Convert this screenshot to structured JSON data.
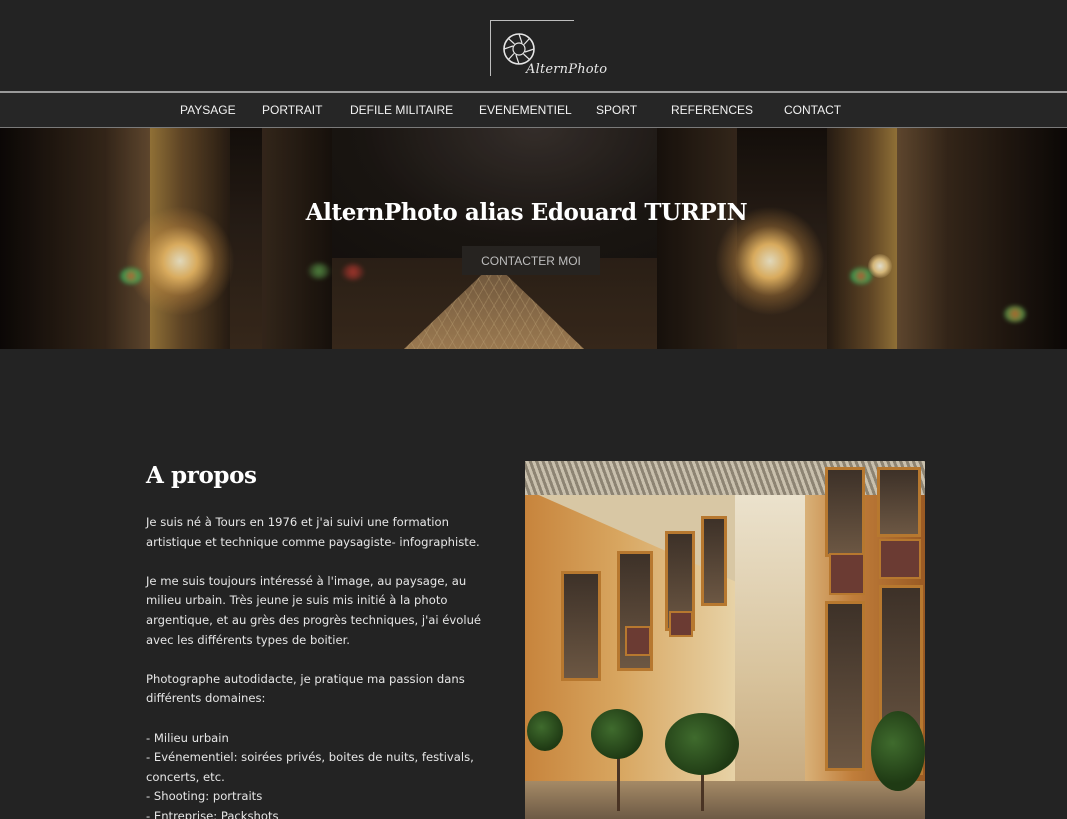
{
  "brand": {
    "logo_text": "AlternPhoto"
  },
  "nav": {
    "items": [
      {
        "label": "PAYSAGE"
      },
      {
        "label": "PORTRAIT"
      },
      {
        "label": "DEFILE MILITAIRE"
      },
      {
        "label": "EVENEMENTIEL"
      },
      {
        "label": "SPORT"
      },
      {
        "label": "REFERENCES"
      },
      {
        "label": "CONTACT"
      }
    ]
  },
  "hero": {
    "title": "AlternPhoto alias Edouard TURPIN",
    "button_label": "CONTACTER MOI"
  },
  "about": {
    "title": "A propos",
    "paragraphs": [
      "Je suis né à Tours en 1976 et j'ai suivi une formation artistique et technique comme paysagiste- infographiste.",
      "Je me suis toujours intéressé à l'image, au paysage, au milieu urbain. Très jeune je suis mis initié à la photo argentique, et au grès des progrès techniques, j'ai évolué avec les différents types de boitier.",
      "Photographe autodidacte, je pratique ma passion dans différents domaines:"
    ],
    "list": [
      "- Milieu urbain",
      "- Evénementiel: soirées privés, boites de nuits, festivals, concerts, etc.",
      "- Shooting: portraits",
      "- Entreprise: Packshots"
    ]
  },
  "colors": {
    "background": "#232323",
    "nav_border": "#9a9a9a",
    "button_bg": "#262320"
  }
}
